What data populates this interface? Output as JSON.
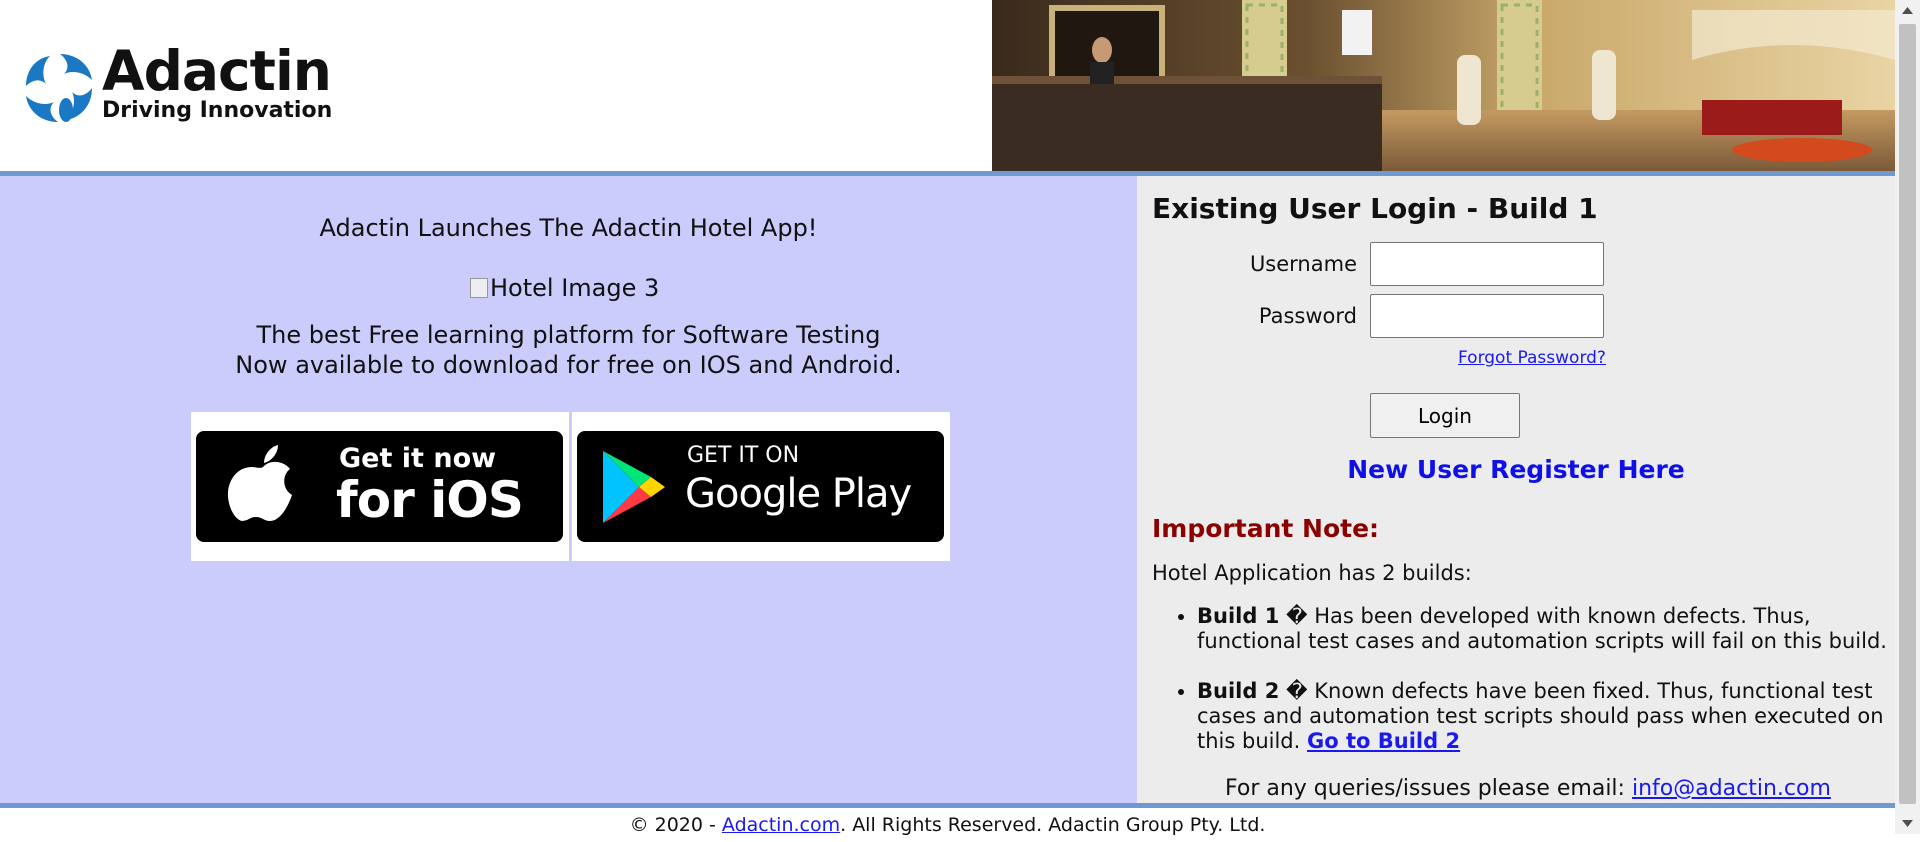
{
  "header": {
    "logo_name": "Adactin",
    "logo_tagline": "Driving Innovation",
    "hero_image_icon": "hotel-lobby-photo"
  },
  "promo": {
    "headline": "Adactin Launches The Adactin Hotel App!",
    "broken_image_alt": "Hotel Image 3",
    "blurb_line1": "The best Free learning platform for Software Testing",
    "blurb_line2": "Now available to download for free on IOS and Android.",
    "ios_badge": {
      "small": "Get it now",
      "large": "for iOS"
    },
    "play_badge": {
      "small": "GET IT ON",
      "large": "Google Play"
    }
  },
  "login": {
    "title": "Existing User Login - Build 1",
    "username_label": "Username",
    "username_value": "",
    "password_label": "Password",
    "password_value": "",
    "forgot_link": "Forgot Password?",
    "login_button": "Login",
    "register_link": "New User Register Here"
  },
  "note": {
    "title": "Important Note:",
    "intro": "Hotel Application has 2 builds:",
    "builds": [
      {
        "name": "Build 1",
        "separator": "�",
        "text": "Has been developed with known defects. Thus, functional test cases and automation scripts will fail on this build."
      },
      {
        "name": "Build 2",
        "separator": "�",
        "text": "Known defects have been fixed. Thus, functional test cases and automation test scripts should pass when executed on this build.",
        "link": "Go to Build 2"
      }
    ],
    "email_prefix": "For any queries/issues please email:",
    "email": "info@adactin.com"
  },
  "footer": {
    "prefix": "© 2020 -",
    "link": "Adactin.com",
    "suffix": ". All Rights Reserved. Adactin Group Pty. Ltd."
  },
  "colors": {
    "left_panel_bg": "#ccccfc",
    "right_panel_bg": "#ececec",
    "rule": "#6f9ad1",
    "link": "#1a1aee",
    "register": "#0f0fe8",
    "note_title": "#8b0000"
  }
}
